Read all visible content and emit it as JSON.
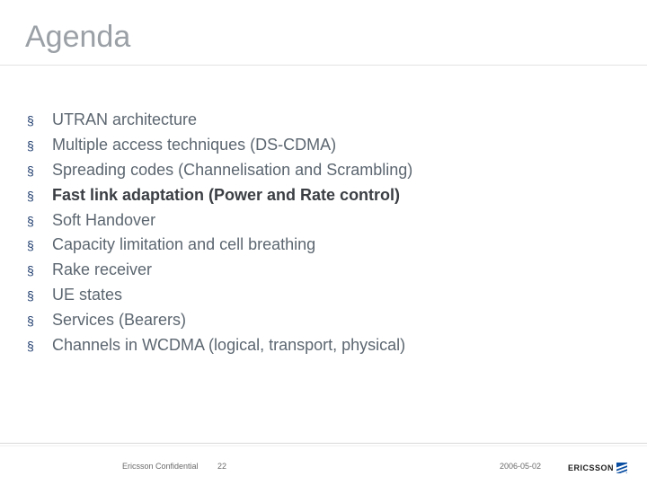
{
  "title": "Agenda",
  "items": [
    {
      "label": "UTRAN architecture",
      "bold": false
    },
    {
      "label": "Multiple access techniques (DS-CDMA)",
      "bold": false
    },
    {
      "label": "Spreading codes (Channelisation and Scrambling)",
      "bold": false
    },
    {
      "label": "Fast link adaptation (Power and Rate control)",
      "bold": true
    },
    {
      "label": "Soft Handover",
      "bold": false
    },
    {
      "label": "Capacity limitation and cell breathing",
      "bold": false
    },
    {
      "label": "Rake receiver",
      "bold": false
    },
    {
      "label": "UE states",
      "bold": false
    },
    {
      "label": "Services (Bearers)",
      "bold": false
    },
    {
      "label": "Channels in WCDMA (logical, transport, physical)",
      "bold": false
    }
  ],
  "footer": {
    "confidential": "Ericsson Confidential",
    "page": "22",
    "date": "2006-05-02",
    "brand": "ERICSSON"
  },
  "bullet_char": "§"
}
